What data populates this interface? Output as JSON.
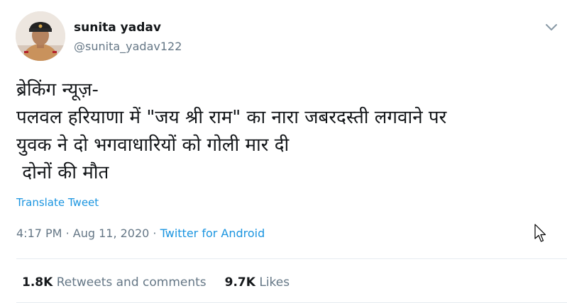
{
  "user": {
    "display_name": "sunita yadav",
    "handle": "@sunita_yadav122"
  },
  "tweet": {
    "lines": [
      "ब्रेकिंग न्यूज़-",
      "पलवल हरियाणा में \"जय श्री राम\" का नारा जबरदस्ती लगवाने पर",
      "युवक ने दो भगवाधारियों को गोली मार दी",
      " दोनों की मौत"
    ],
    "translate_label": "Translate Tweet",
    "time": "4:17 PM",
    "separator": "·",
    "date": "Aug 11, 2020",
    "source": "Twitter for Android"
  },
  "stats": {
    "retweets_count": "1.8K",
    "retweets_label": "Retweets and comments",
    "likes_count": "9.7K",
    "likes_label": "Likes"
  },
  "icons": {
    "caret": "chevron-down-icon",
    "cursor": "mouse-pointer-icon"
  },
  "colors": {
    "link": "#1b95e0",
    "secondary": "#657786",
    "primary_text": "#14171a",
    "divider": "#e6ecf0"
  }
}
